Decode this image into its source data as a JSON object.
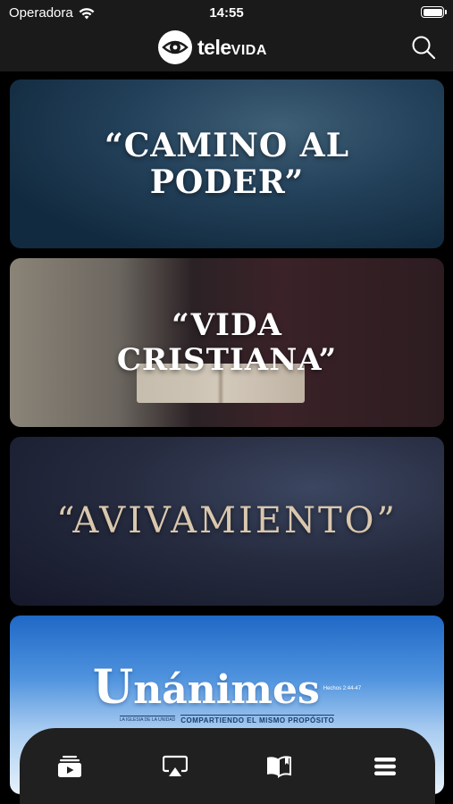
{
  "status_bar": {
    "carrier": "Operadora",
    "time": "14:55",
    "icons": [
      "wifi-icon",
      "battery-icon"
    ]
  },
  "header": {
    "logo_prefix": "tele",
    "logo_suffix": "VIDA",
    "icons": [
      "televida-logo-icon",
      "search-icon"
    ]
  },
  "cards": [
    {
      "title_line1": "“CAMINO AL",
      "title_line2": "PODER”"
    },
    {
      "title_line1": "“VIDA",
      "title_line2": "CRISTIANA”"
    },
    {
      "title_line1": "“AVIVAMIENTO”"
    },
    {
      "title_cap": "U",
      "title_rest": "nánimes",
      "reference": "Hechos 2:44-47",
      "sub_left": "LA IGLESIA DE LA UNIDAD",
      "tagline": "COMPARTIENDO EL MISMO PROPÓSITO"
    }
  ],
  "tab_bar": {
    "icons": [
      "video-library-icon",
      "airplay-icon",
      "bible-icon",
      "menu-icon"
    ]
  },
  "colors": {
    "bar_background": "#1a1a1a",
    "tab_bar_background": "#202020",
    "avivamiento_text": "#d9c7ae"
  }
}
